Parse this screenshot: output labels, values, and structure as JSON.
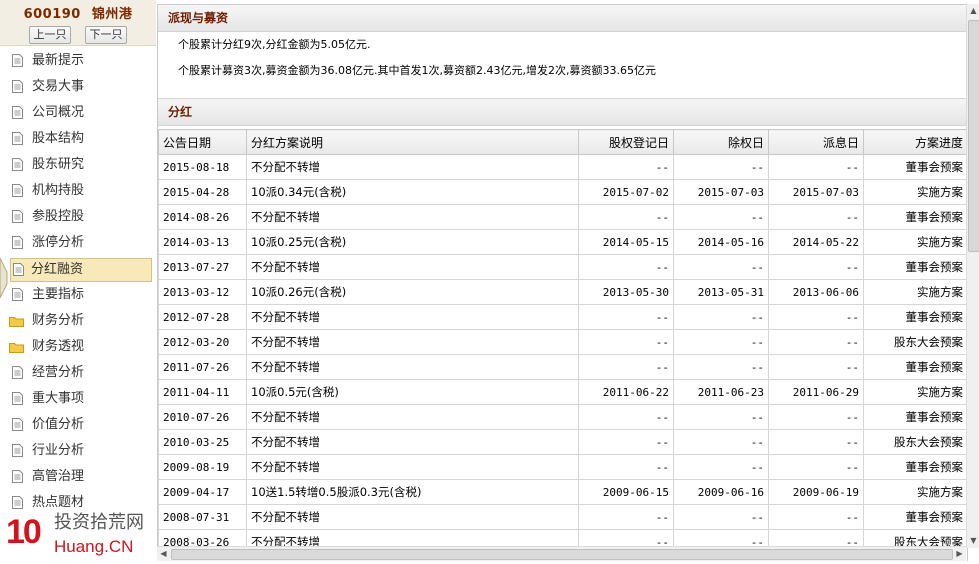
{
  "stock": {
    "code": "600190",
    "name": "锦州港"
  },
  "nav": {
    "prev": "上一只",
    "next": "下一只"
  },
  "sidebar": {
    "items": [
      {
        "label": "最新提示",
        "icon": "document-icon"
      },
      {
        "label": "交易大事",
        "icon": "document-icon"
      },
      {
        "label": "公司概况",
        "icon": "document-icon"
      },
      {
        "label": "股本结构",
        "icon": "document-icon"
      },
      {
        "label": "股东研究",
        "icon": "document-icon"
      },
      {
        "label": "机构持股",
        "icon": "document-icon"
      },
      {
        "label": "参股控股",
        "icon": "document-icon"
      },
      {
        "label": "涨停分析",
        "icon": "document-icon"
      },
      {
        "label": "分红融资",
        "icon": "document-icon",
        "active": true
      },
      {
        "label": "主要指标",
        "icon": "document-icon"
      },
      {
        "label": "财务分析",
        "icon": "folder-icon"
      },
      {
        "label": "财务透视",
        "icon": "folder-icon"
      },
      {
        "label": "经营分析",
        "icon": "document-icon"
      },
      {
        "label": "重大事项",
        "icon": "document-icon"
      },
      {
        "label": "价值分析",
        "icon": "document-icon"
      },
      {
        "label": "行业分析",
        "icon": "document-icon"
      },
      {
        "label": "高管治理",
        "icon": "document-icon"
      },
      {
        "label": "热点题材",
        "icon": "document-icon"
      }
    ]
  },
  "watermark": {
    "num": "10",
    "cn": "投资拾荒网",
    "en": "Huang.CN"
  },
  "summary": {
    "title": "派现与募资",
    "line1": "个股累计分红9次,分红金额为5.05亿元.",
    "line2": "个股累计募资3次,募资金额为36.08亿元.其中首发1次,募资额2.43亿元,增发2次,募资额33.65亿元"
  },
  "dividend": {
    "title": "分红",
    "columns": [
      "公告日期",
      "分红方案说明",
      "股权登记日",
      "除权日",
      "派息日",
      "方案进度"
    ],
    "rows": [
      [
        "2015-08-18",
        "不分配不转增",
        "--",
        "--",
        "--",
        "董事会预案"
      ],
      [
        "2015-04-28",
        "10派0.34元(含税)",
        "2015-07-02",
        "2015-07-03",
        "2015-07-03",
        "实施方案"
      ],
      [
        "2014-08-26",
        "不分配不转增",
        "--",
        "--",
        "--",
        "董事会预案"
      ],
      [
        "2014-03-13",
        "10派0.25元(含税)",
        "2014-05-15",
        "2014-05-16",
        "2014-05-22",
        "实施方案"
      ],
      [
        "2013-07-27",
        "不分配不转增",
        "--",
        "--",
        "--",
        "董事会预案"
      ],
      [
        "2013-03-12",
        "10派0.26元(含税)",
        "2013-05-30",
        "2013-05-31",
        "2013-06-06",
        "实施方案"
      ],
      [
        "2012-07-28",
        "不分配不转增",
        "--",
        "--",
        "--",
        "董事会预案"
      ],
      [
        "2012-03-20",
        "不分配不转增",
        "--",
        "--",
        "--",
        "股东大会预案"
      ],
      [
        "2011-07-26",
        "不分配不转增",
        "--",
        "--",
        "--",
        "董事会预案"
      ],
      [
        "2011-04-11",
        "10派0.5元(含税)",
        "2011-06-22",
        "2011-06-23",
        "2011-06-29",
        "实施方案"
      ],
      [
        "2010-07-26",
        "不分配不转增",
        "--",
        "--",
        "--",
        "董事会预案"
      ],
      [
        "2010-03-25",
        "不分配不转增",
        "--",
        "--",
        "--",
        "股东大会预案"
      ],
      [
        "2009-08-19",
        "不分配不转增",
        "--",
        "--",
        "--",
        "董事会预案"
      ],
      [
        "2009-04-17",
        "10送1.5转增0.5股派0.3元(含税)",
        "2009-06-15",
        "2009-06-16",
        "2009-06-19",
        "实施方案"
      ],
      [
        "2008-07-31",
        "不分配不转增",
        "--",
        "--",
        "--",
        "董事会预案"
      ],
      [
        "2008-03-26",
        "不分配不转增",
        "--",
        "--",
        "--",
        "股东大会预案"
      ]
    ]
  }
}
